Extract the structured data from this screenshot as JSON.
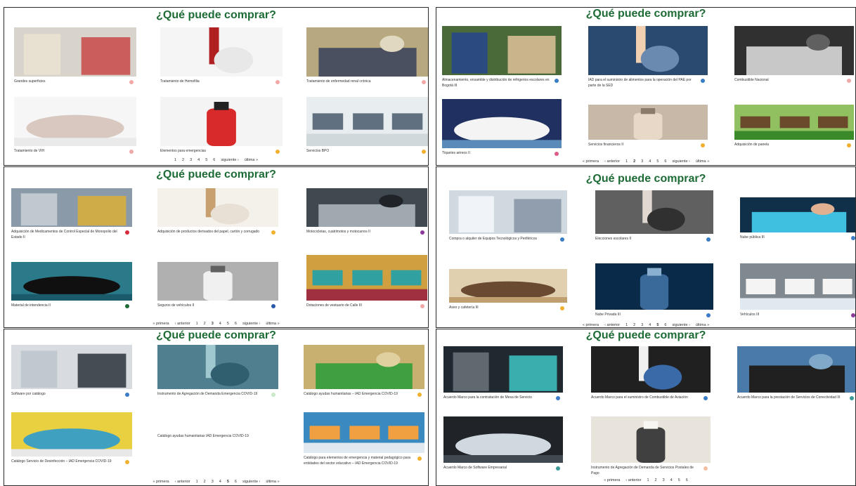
{
  "panels": [
    {
      "title": "¿Qué puede comprar?",
      "items": [
        {
          "caption": "Grandes superficies",
          "badge": "#f2a7a7"
        },
        {
          "caption": "Tratamiento de Hemofilia",
          "badge": "#f2a7a7"
        },
        {
          "caption": "Tratamiento de enfermedad renal crónica",
          "badge": "#f2a7a7"
        },
        {
          "caption": "Tratamiento de VIH",
          "badge": "#f2a7a7"
        },
        {
          "caption": "Elementos para emergencias",
          "badge": "#f0b030"
        },
        {
          "caption": "Servicios BPO",
          "badge": "#f0b030"
        }
      ],
      "pager": [
        "1",
        "2",
        "3",
        "4",
        "5",
        "6",
        "siguiente ›",
        "última »"
      ]
    },
    {
      "title": "¿Qué puede comprar?",
      "items": [
        {
          "caption": "Almacenamiento, ensamble y distribución de refrigerios escolares en Bogotá III",
          "badge": "#3a7cc8"
        },
        {
          "caption": "IAD para el suministro de alimentos para la operación del PAE por parte de la SED",
          "badge": "#3a7cc8"
        },
        {
          "caption": "Combustible Nacional",
          "badge": "#f2a7a7"
        },
        {
          "caption": "Tiquetes aéreos II",
          "badge": "#e05a8a"
        },
        {
          "caption": "Servicios financieros II",
          "badge": "#f0b030"
        },
        {
          "caption": "Adquisición de panela",
          "badge": "#f0b030"
        }
      ],
      "pager": [
        "« primera",
        "‹ anterior",
        "1",
        "2",
        "3",
        "4",
        "5",
        "6",
        "siguiente ›",
        "última »"
      ]
    },
    {
      "title": "¿Qué puede comprar?",
      "items": [
        {
          "caption": "Adquisición de Medicamentos de Control Especial de Monopolio del Estado II",
          "badge": "#d8283c"
        },
        {
          "caption": "Adquisición de productos derivados del papel, cartón y corrugado",
          "badge": "#f0b030"
        },
        {
          "caption": "Motocicletas, cuatrimotos y motocarros II",
          "badge": "#8a3a9a"
        },
        {
          "caption": "Material de intendencia II",
          "badge": "#1d6b35"
        },
        {
          "caption": "Seguros de vehículos II",
          "badge": "#2a5aa8"
        },
        {
          "caption": "Dotaciones de vestuario de Calle III",
          "badge": "#f2a7a7"
        }
      ],
      "pager": [
        "« primera",
        "‹ anterior",
        "1",
        "2",
        "3",
        "4",
        "5",
        "6",
        "siguiente ›",
        "última »"
      ]
    },
    {
      "title": "¿Qué puede comprar?",
      "items": [
        {
          "caption": "Compra o alquiler de Equipos Tecnológicos y Periféricos",
          "badge": "#3a7cc8"
        },
        {
          "caption": "Elecciones escolares II",
          "badge": "#3a7cc8"
        },
        {
          "caption": "Nube pública III",
          "badge": "#3a7cc8"
        },
        {
          "caption": "Aseo y cafetería III",
          "badge": "#f0b030"
        },
        {
          "caption": "Nube Privada III",
          "badge": "#3a7cc8"
        },
        {
          "caption": "Vehículos III",
          "badge": "#8a3a9a"
        }
      ],
      "pager": [
        "« primera",
        "‹ anterior",
        "1",
        "2",
        "3",
        "4",
        "5",
        "6",
        "siguiente ›",
        "última »"
      ]
    },
    {
      "title": "¿Qué puede comprar?",
      "items": [
        {
          "caption": "Software por catálogo",
          "badge": "#3a7cc8"
        },
        {
          "caption": "Instrumento de Agregación de Demanda Emergencia COVID-19",
          "badge": "#c8e8c8"
        },
        {
          "caption": "Catálogo ayudas humanitarias – IAD Emergencia COVID-19",
          "badge": "#f0b030"
        },
        {
          "caption": "Catálogo Servicio de Desinfección – IAD Emergencia COVID-19",
          "badge": "#f0b030"
        },
        {
          "caption": "Catálogo ayudas humanitarias IAD Emergencia COVID-19",
          "badge": ""
        },
        {
          "caption": "Catálogo para elementos de emergencia y material pedagógico para entidades del sector educativo – IAD Emergencia COVID-19",
          "badge": "#f0b030"
        }
      ],
      "pager": [
        "« primera",
        "‹ anterior",
        "1",
        "2",
        "3",
        "4",
        "5",
        "6",
        "siguiente ›",
        "última »"
      ]
    },
    {
      "title": "¿Qué puede comprar?",
      "items": [
        {
          "caption": "Acuerdo Marco para la contratación de Mesa de Servicio",
          "badge": "#3a7cc8"
        },
        {
          "caption": "Acuerdo Marco para el suministro de Combustible de Aviación",
          "badge": "#3a7cc8"
        },
        {
          "caption": "Acuerdo Marco para la prestación de Servicios de Conectividad III",
          "badge": "#3a9a9a"
        },
        {
          "caption": "Acuerdo Marco de Software Empresarial",
          "badge": "#3a9a9a"
        },
        {
          "caption": "Instrumento de Agregación de Demanda de Servicios Postales de Pago",
          "badge": "#f2c0a0"
        }
      ],
      "pager": [
        "« primera",
        "‹ anterior",
        "1",
        "2",
        "3",
        "4",
        "5",
        "6"
      ]
    }
  ]
}
